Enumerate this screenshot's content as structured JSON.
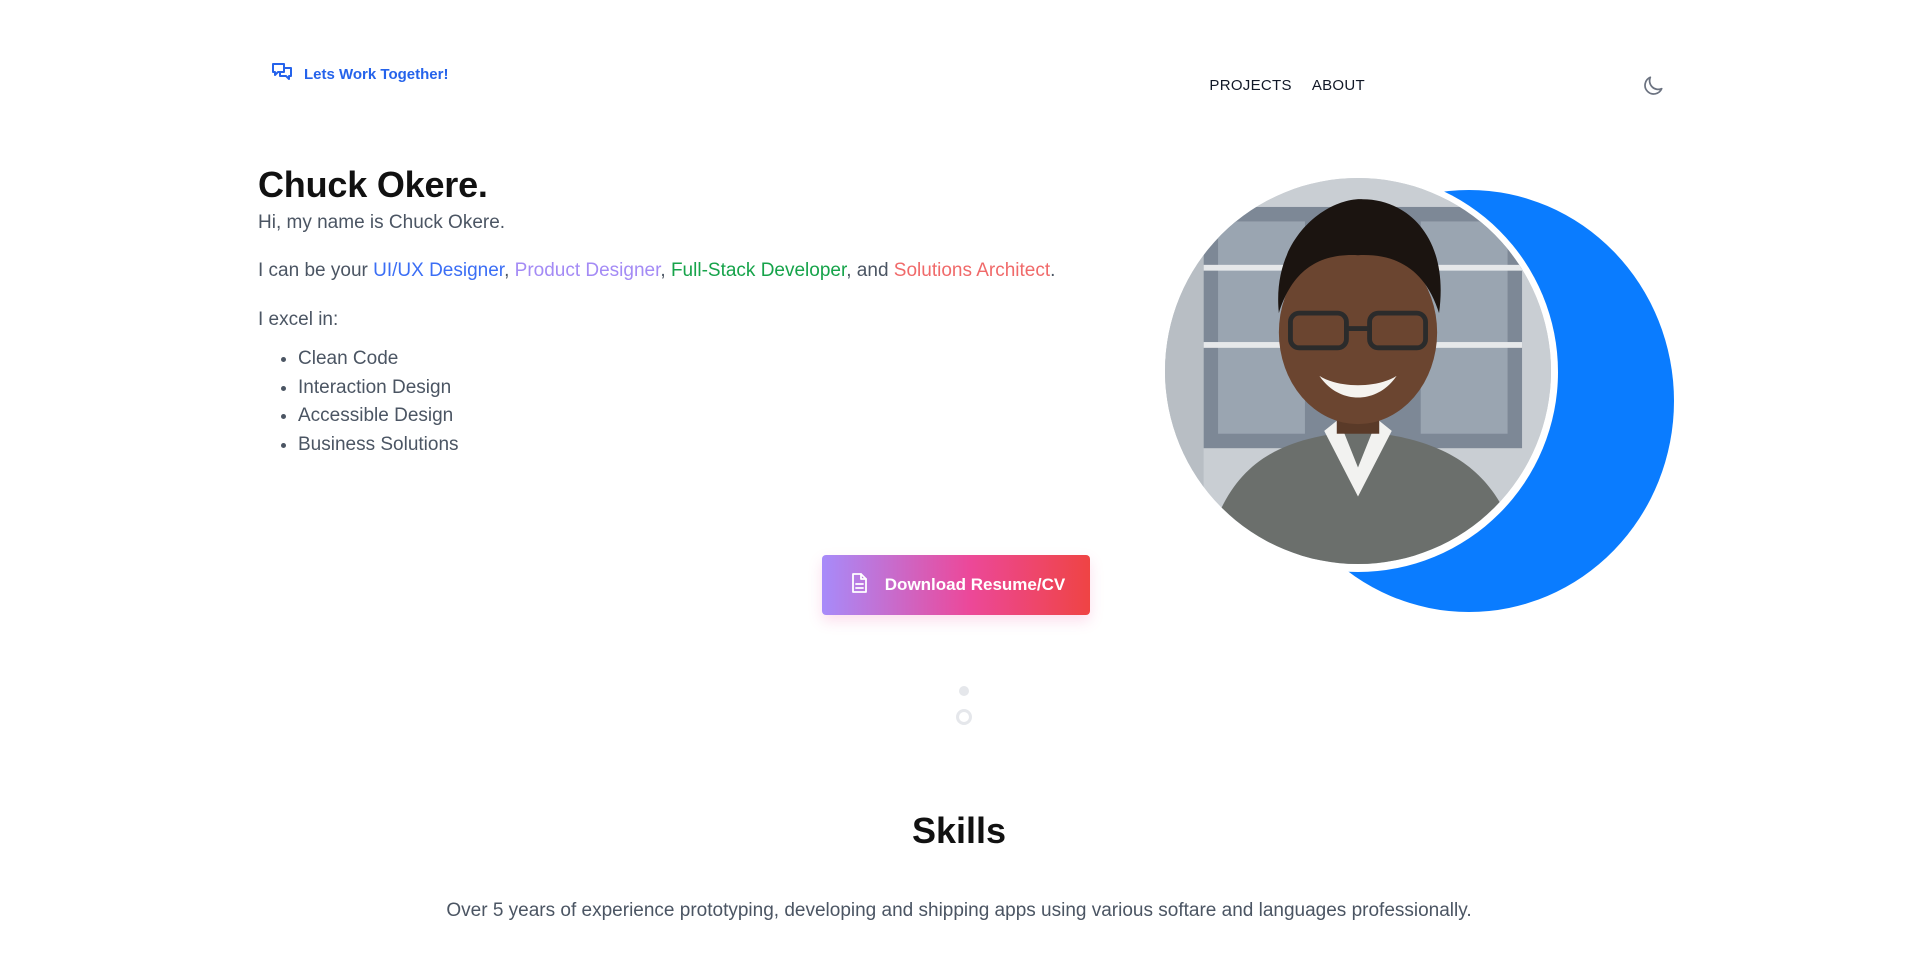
{
  "header": {
    "contact_label": "Lets Work Together!",
    "contact_icon": "chat-bubbles-icon",
    "nav": [
      {
        "label": "PROJECTS"
      },
      {
        "label": "ABOUT"
      }
    ],
    "theme_icon": "moon-icon"
  },
  "hero": {
    "name": "Chuck Okere.",
    "greeting": "Hi, my name is Chuck Okere.",
    "roles_intro": "I can be your ",
    "roles": [
      "UI/UX Designer",
      "Product Designer",
      "Full-Stack Developer",
      "Solutions Architect"
    ],
    "roles_sep": ", ",
    "roles_and": ", and ",
    "roles_end": ".",
    "excel_label": "I excel in:",
    "excel_items": [
      "Clean Code",
      "Interaction Design",
      "Accessible Design",
      "Business Solutions"
    ],
    "download_label": "Download Resume/CV",
    "download_icon": "document-icon",
    "accent_color": "#0a7cff"
  },
  "skills": {
    "title": "Skills",
    "description": "Over 5 years of experience prototyping, developing and shipping apps using various softare and languages professionally."
  }
}
